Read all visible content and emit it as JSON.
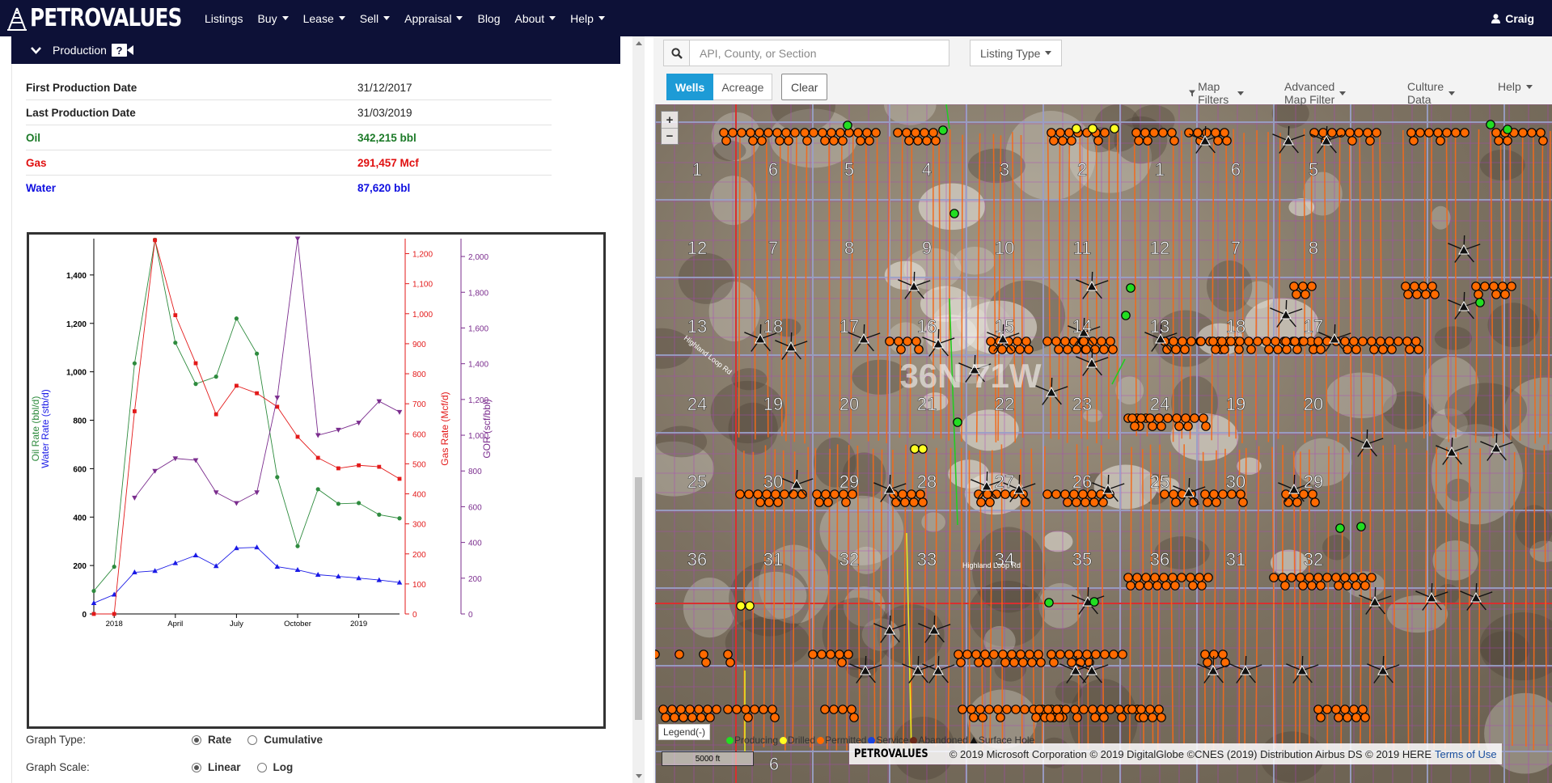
{
  "brand": "PETROVALUES",
  "nav": {
    "items": [
      {
        "label": "Listings",
        "dropdown": false
      },
      {
        "label": "Buy",
        "dropdown": true
      },
      {
        "label": "Lease",
        "dropdown": true
      },
      {
        "label": "Sell",
        "dropdown": true
      },
      {
        "label": "Appraisal",
        "dropdown": true
      },
      {
        "label": "Blog",
        "dropdown": false
      },
      {
        "label": "About",
        "dropdown": true
      },
      {
        "label": "Help",
        "dropdown": true
      }
    ],
    "user": "Craig"
  },
  "production": {
    "title": "Production",
    "help_badge": "?",
    "rows": [
      {
        "label": "First Production Date",
        "value": "31/12/2017",
        "style": "plain"
      },
      {
        "label": "Last Production Date",
        "value": "31/03/2019",
        "style": "plain"
      },
      {
        "label": "Oil",
        "value": "342,215 bbl",
        "style": "oil"
      },
      {
        "label": "Gas",
        "value": "291,457 Mcf",
        "style": "gas"
      },
      {
        "label": "Water",
        "value": "87,620 bbl",
        "style": "water"
      }
    ]
  },
  "chart_data": {
    "type": "line",
    "x": [
      "2017-12",
      "2018-01",
      "2018-02",
      "2018-03",
      "2018-04",
      "2018-05",
      "2018-06",
      "2018-07",
      "2018-08",
      "2018-09",
      "2018-10",
      "2018-11",
      "2018-12",
      "2019-01",
      "2019-02",
      "2019-03"
    ],
    "x_tick_labels": [
      "2018",
      "April",
      "July",
      "October",
      "2019"
    ],
    "ylabel_left_1": "Oil Rate (bbl/d)",
    "ylabel_left_2": "Water Rate (stb/d)",
    "ylabel_right_1": "Gas Rate (Mcf/d)",
    "ylabel_right_2": "GOR (scf/bbl)",
    "left_axis": {
      "ylim": [
        0,
        1550
      ],
      "ticks": [
        "0",
        "200",
        "400",
        "600",
        "800",
        "1,000",
        "1,200",
        "1,400"
      ]
    },
    "gas_axis": {
      "ylim": [
        0,
        1250
      ],
      "ticks": [
        "0",
        "100",
        "200",
        "300",
        "400",
        "500",
        "600",
        "700",
        "800",
        "900",
        "1,000",
        "1,100",
        "1,200"
      ]
    },
    "gor_axis": {
      "ylim": [
        0,
        2100
      ],
      "ticks": [
        "0",
        "200",
        "400",
        "600",
        "800",
        "1,000",
        "1,200",
        "1,400",
        "1,600",
        "1,800",
        "2,000"
      ]
    },
    "series": [
      {
        "name": "Oil Rate (bbl/d)",
        "axis": "left",
        "color": "#2e8b3e",
        "marker": "circle",
        "values": [
          95,
          195,
          1035,
          1545,
          1120,
          950,
          980,
          1220,
          1075,
          565,
          280,
          515,
          455,
          458,
          410,
          395
        ]
      },
      {
        "name": "Water Rate (stb/d)",
        "axis": "left",
        "color": "#1a1ae6",
        "marker": "triangle",
        "values": [
          45,
          80,
          172,
          178,
          210,
          242,
          198,
          272,
          275,
          195,
          182,
          162,
          155,
          148,
          140,
          130
        ]
      },
      {
        "name": "Gas Rate (Mcf/d)",
        "axis": "gas",
        "color": "#e31a1a",
        "marker": "square",
        "values": [
          0,
          0,
          675,
          1245,
          995,
          835,
          665,
          760,
          735,
          690,
          590,
          520,
          485,
          495,
          490,
          450
        ]
      },
      {
        "name": "GOR (scf/bbl)",
        "axis": "gor",
        "color": "#7b2d8e",
        "marker": "triangle-down",
        "values": [
          null,
          null,
          650,
          800,
          870,
          860,
          680,
          620,
          680,
          1210,
          2100,
          1000,
          1030,
          1070,
          1190,
          1130
        ]
      }
    ]
  },
  "graph_type": {
    "label": "Graph Type:",
    "options": [
      "Rate",
      "Cumulative"
    ],
    "selected": "Rate"
  },
  "graph_scale": {
    "label": "Graph Scale:",
    "options": [
      "Linear",
      "Log"
    ],
    "selected": "Linear"
  },
  "search": {
    "placeholder": "API, County, or Section"
  },
  "listing_type": "Listing Type",
  "toggles": {
    "wells": "Wells",
    "acreage": "Acreage",
    "clear": "Clear"
  },
  "map_menus": [
    "Map Filters",
    "Advanced Map Filter",
    "Culture Data",
    "Help"
  ],
  "map": {
    "township_label": "36N 71W",
    "road_labels": [
      "Highland Loop Rd",
      "Highland Loop Rd"
    ],
    "sections": [
      [
        "1",
        "6",
        "5",
        "4",
        "3",
        "2",
        "1",
        "6",
        "5"
      ],
      [
        "12",
        "7",
        "8",
        "9",
        "10",
        "11",
        "12",
        "7",
        "8"
      ],
      [
        "13",
        "18",
        "17",
        "16",
        "15",
        "14",
        "13",
        "18",
        "17"
      ],
      [
        "24",
        "19",
        "20",
        "21",
        "22",
        "23",
        "24",
        "19",
        "20"
      ],
      [
        "25",
        "30",
        "29",
        "28",
        "27",
        "26",
        "25",
        "30",
        "29"
      ],
      [
        "36",
        "31",
        "32",
        "33",
        "34",
        "35",
        "36",
        "31",
        "32"
      ]
    ],
    "zoom_in": "+",
    "zoom_out": "−",
    "legend_button": "Legend(-)",
    "legend": [
      {
        "label": "Producing",
        "color": "#22dd22",
        "shape": "dot"
      },
      {
        "label": "Drilled",
        "color": "#ffff22",
        "shape": "dot"
      },
      {
        "label": "Permitted",
        "color": "#ff6a00",
        "shape": "dot"
      },
      {
        "label": "Service",
        "color": "#1a44dd",
        "shape": "dot"
      },
      {
        "label": "Abandoned",
        "color": "#6a2a1a",
        "shape": "dot"
      },
      {
        "label": "Surface Hole",
        "color": "#111111",
        "shape": "triangle"
      }
    ],
    "scale": "5000 ft",
    "bottom_section": "6",
    "attribution_logo": "PETROVALUES",
    "attribution": "© 2019 Microsoft Corporation © 2019 DigitalGlobe ©CNES (2019) Distribution Airbus DS © 2019 HERE",
    "terms": "Terms of Use",
    "colors": {
      "lateral": "#f26a1b",
      "grid_line": "#b040c0",
      "section_line": "#9aa0c8"
    }
  }
}
